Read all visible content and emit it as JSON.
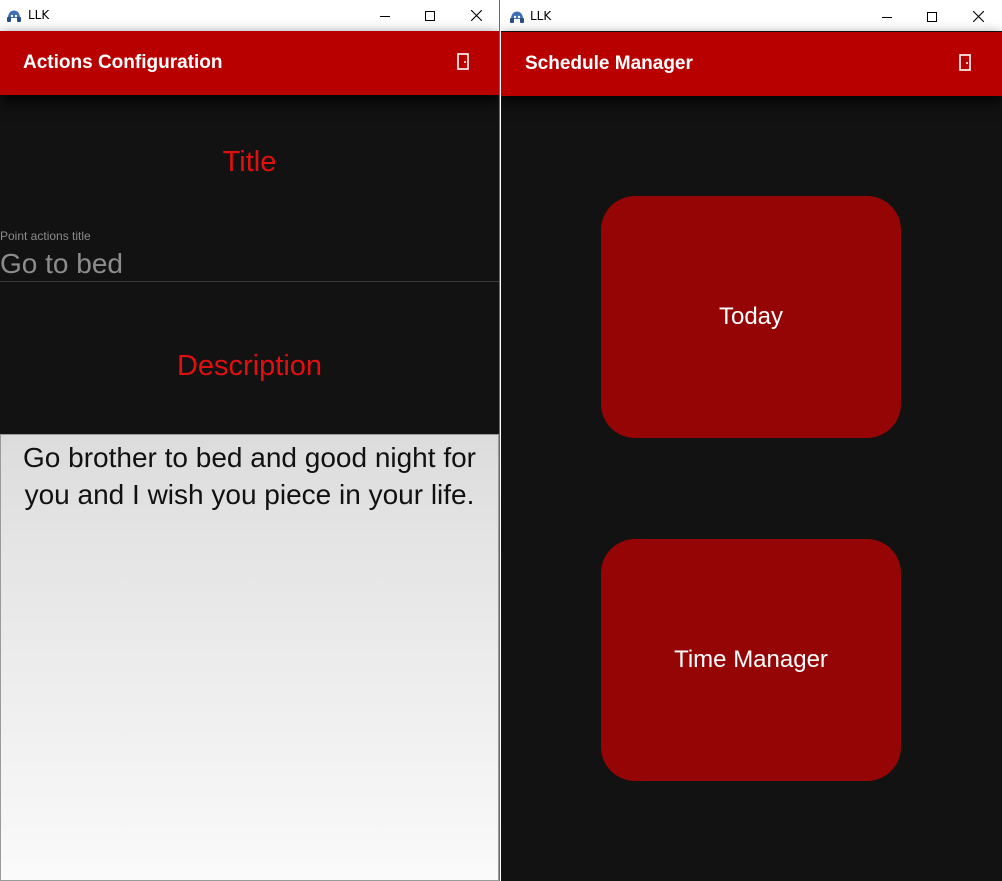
{
  "colors": {
    "appbar": "#b80000",
    "background": "#121212",
    "heading_red": "#e01010",
    "button_red": "#950505"
  },
  "left_window": {
    "titlebar": {
      "app_icon": "llk-app-icon",
      "title": "LLK",
      "minimize_icon": "minimize-icon",
      "maximize_icon": "maximize-icon",
      "close_icon": "close-icon"
    },
    "appbar": {
      "title": "Actions Configuration",
      "action_icon": "exit-door-icon"
    },
    "title_section": {
      "heading": "Title",
      "field_label": "Point actions title",
      "field_value": "Go to bed"
    },
    "description_section": {
      "heading": "Description",
      "text": "Go brother to bed and good night for you and I wish you piece in your life."
    }
  },
  "right_window": {
    "titlebar": {
      "app_icon": "llk-app-icon",
      "title": "LLK",
      "minimize_icon": "minimize-icon",
      "maximize_icon": "maximize-icon",
      "close_icon": "close-icon"
    },
    "appbar": {
      "title": "Schedule Manager",
      "action_icon": "exit-door-icon"
    },
    "buttons": [
      {
        "label": "Today"
      },
      {
        "label": "Time Manager"
      }
    ]
  }
}
